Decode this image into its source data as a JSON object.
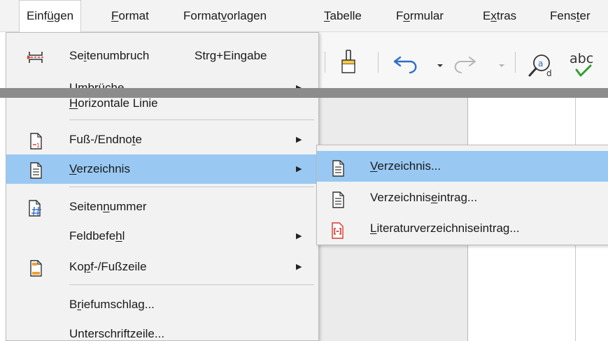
{
  "menubar": {
    "items": [
      {
        "pre": "Einf",
        "key": "ü",
        "post": "gen"
      },
      {
        "pre": "",
        "key": "F",
        "post": "ormat"
      },
      {
        "pre": "Format",
        "key": "v",
        "post": "orlagen"
      },
      {
        "pre": "",
        "key": "T",
        "post": "abelle"
      },
      {
        "pre": "F",
        "key": "o",
        "post": "rmular"
      },
      {
        "pre": "E",
        "key": "x",
        "post": "tras"
      },
      {
        "pre": "Fens",
        "key": "t",
        "post": "er"
      }
    ]
  },
  "toolbar": {
    "icons": [
      "page-break-icon",
      "clone-formatting-icon",
      "undo-icon",
      "redo-icon",
      "find-replace-icon",
      "spelling-icon"
    ],
    "partial_text": "abc"
  },
  "menu": {
    "items": [
      {
        "pre": "Se",
        "key": "i",
        "post": "tenumbruch",
        "shortcut": "Strg+Eingabe",
        "icon": "page-break-icon",
        "submenu": false
      },
      {
        "pre": "",
        "key": "U",
        "post": "mbrüche",
        "icon": "",
        "submenu": true
      },
      {
        "pre": "",
        "key": "H",
        "post": "orizontale Linie",
        "icon": "",
        "submenu": false
      },
      {
        "pre": "Fuß-/Endno",
        "key": "t",
        "post": "e",
        "icon": "footnote-icon",
        "submenu": true
      },
      {
        "pre": "",
        "key": "V",
        "post": "erzeichnis",
        "icon": "table-of-contents-icon",
        "submenu": true
      },
      {
        "pre": "Seiten",
        "key": "n",
        "post": "ummer",
        "icon": "page-number-icon",
        "submenu": false
      },
      {
        "pre": "Feldbefe",
        "key": "h",
        "post": "l",
        "icon": "",
        "submenu": true
      },
      {
        "pre": "Ko",
        "key": "p",
        "post": "f-/Fußzeile",
        "icon": "header-footer-icon",
        "submenu": true
      },
      {
        "pre": "B",
        "key": "r",
        "post": "iefumschlag...",
        "icon": "",
        "submenu": false
      },
      {
        "pre": "Unterschriftzeile...",
        "key": "",
        "post": "",
        "icon": "",
        "submenu": false
      }
    ]
  },
  "submenu": {
    "items": [
      {
        "pre": "",
        "key": "V",
        "post": "erzeichnis...",
        "icon": "table-of-contents-icon"
      },
      {
        "pre": "Verzeichnis",
        "key": "e",
        "post": "intrag...",
        "icon": "index-entry-icon"
      },
      {
        "pre": "",
        "key": "L",
        "post": "iteraturverzeichniseintrag...",
        "icon": "bibliography-entry-icon"
      }
    ]
  },
  "colors": {
    "highlight": "#99c9f3",
    "menu_bg": "#f2f2f2",
    "icon_red": "#d9352a",
    "undo_blue": "#2d6dc7",
    "check_green": "#2fa12f"
  }
}
